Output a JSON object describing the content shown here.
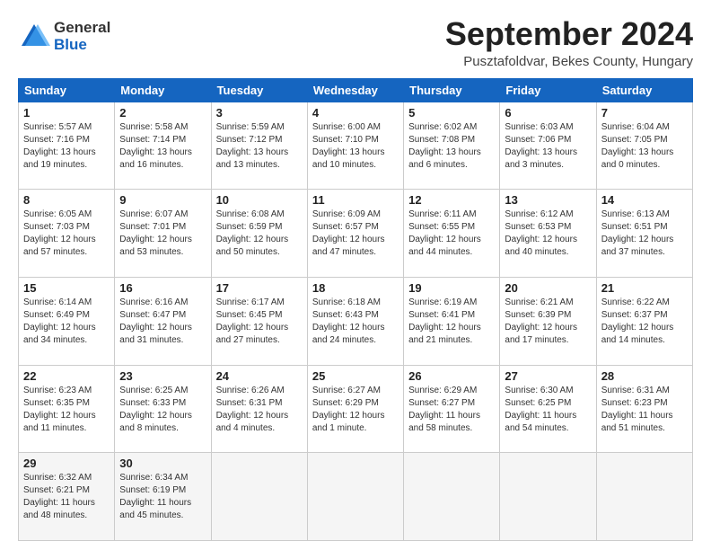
{
  "logo": {
    "general": "General",
    "blue": "Blue"
  },
  "header": {
    "month": "September 2024",
    "location": "Pusztafoldvar, Bekes County, Hungary"
  },
  "weekdays": [
    "Sunday",
    "Monday",
    "Tuesday",
    "Wednesday",
    "Thursday",
    "Friday",
    "Saturday"
  ],
  "weeks": [
    [
      {
        "day": "1",
        "sunrise": "5:57 AM",
        "sunset": "7:16 PM",
        "daylight": "13 hours and 19 minutes."
      },
      {
        "day": "2",
        "sunrise": "5:58 AM",
        "sunset": "7:14 PM",
        "daylight": "13 hours and 16 minutes."
      },
      {
        "day": "3",
        "sunrise": "5:59 AM",
        "sunset": "7:12 PM",
        "daylight": "13 hours and 13 minutes."
      },
      {
        "day": "4",
        "sunrise": "6:00 AM",
        "sunset": "7:10 PM",
        "daylight": "13 hours and 10 minutes."
      },
      {
        "day": "5",
        "sunrise": "6:02 AM",
        "sunset": "7:08 PM",
        "daylight": "13 hours and 6 minutes."
      },
      {
        "day": "6",
        "sunrise": "6:03 AM",
        "sunset": "7:06 PM",
        "daylight": "13 hours and 3 minutes."
      },
      {
        "day": "7",
        "sunrise": "6:04 AM",
        "sunset": "7:05 PM",
        "daylight": "13 hours and 0 minutes."
      }
    ],
    [
      {
        "day": "8",
        "sunrise": "6:05 AM",
        "sunset": "7:03 PM",
        "daylight": "12 hours and 57 minutes."
      },
      {
        "day": "9",
        "sunrise": "6:07 AM",
        "sunset": "7:01 PM",
        "daylight": "12 hours and 53 minutes."
      },
      {
        "day": "10",
        "sunrise": "6:08 AM",
        "sunset": "6:59 PM",
        "daylight": "12 hours and 50 minutes."
      },
      {
        "day": "11",
        "sunrise": "6:09 AM",
        "sunset": "6:57 PM",
        "daylight": "12 hours and 47 minutes."
      },
      {
        "day": "12",
        "sunrise": "6:11 AM",
        "sunset": "6:55 PM",
        "daylight": "12 hours and 44 minutes."
      },
      {
        "day": "13",
        "sunrise": "6:12 AM",
        "sunset": "6:53 PM",
        "daylight": "12 hours and 40 minutes."
      },
      {
        "day": "14",
        "sunrise": "6:13 AM",
        "sunset": "6:51 PM",
        "daylight": "12 hours and 37 minutes."
      }
    ],
    [
      {
        "day": "15",
        "sunrise": "6:14 AM",
        "sunset": "6:49 PM",
        "daylight": "12 hours and 34 minutes."
      },
      {
        "day": "16",
        "sunrise": "6:16 AM",
        "sunset": "6:47 PM",
        "daylight": "12 hours and 31 minutes."
      },
      {
        "day": "17",
        "sunrise": "6:17 AM",
        "sunset": "6:45 PM",
        "daylight": "12 hours and 27 minutes."
      },
      {
        "day": "18",
        "sunrise": "6:18 AM",
        "sunset": "6:43 PM",
        "daylight": "12 hours and 24 minutes."
      },
      {
        "day": "19",
        "sunrise": "6:19 AM",
        "sunset": "6:41 PM",
        "daylight": "12 hours and 21 minutes."
      },
      {
        "day": "20",
        "sunrise": "6:21 AM",
        "sunset": "6:39 PM",
        "daylight": "12 hours and 17 minutes."
      },
      {
        "day": "21",
        "sunrise": "6:22 AM",
        "sunset": "6:37 PM",
        "daylight": "12 hours and 14 minutes."
      }
    ],
    [
      {
        "day": "22",
        "sunrise": "6:23 AM",
        "sunset": "6:35 PM",
        "daylight": "12 hours and 11 minutes."
      },
      {
        "day": "23",
        "sunrise": "6:25 AM",
        "sunset": "6:33 PM",
        "daylight": "12 hours and 8 minutes."
      },
      {
        "day": "24",
        "sunrise": "6:26 AM",
        "sunset": "6:31 PM",
        "daylight": "12 hours and 4 minutes."
      },
      {
        "day": "25",
        "sunrise": "6:27 AM",
        "sunset": "6:29 PM",
        "daylight": "12 hours and 1 minute."
      },
      {
        "day": "26",
        "sunrise": "6:29 AM",
        "sunset": "6:27 PM",
        "daylight": "11 hours and 58 minutes."
      },
      {
        "day": "27",
        "sunrise": "6:30 AM",
        "sunset": "6:25 PM",
        "daylight": "11 hours and 54 minutes."
      },
      {
        "day": "28",
        "sunrise": "6:31 AM",
        "sunset": "6:23 PM",
        "daylight": "11 hours and 51 minutes."
      }
    ],
    [
      {
        "day": "29",
        "sunrise": "6:32 AM",
        "sunset": "6:21 PM",
        "daylight": "11 hours and 48 minutes."
      },
      {
        "day": "30",
        "sunrise": "6:34 AM",
        "sunset": "6:19 PM",
        "daylight": "11 hours and 45 minutes."
      },
      null,
      null,
      null,
      null,
      null
    ]
  ]
}
